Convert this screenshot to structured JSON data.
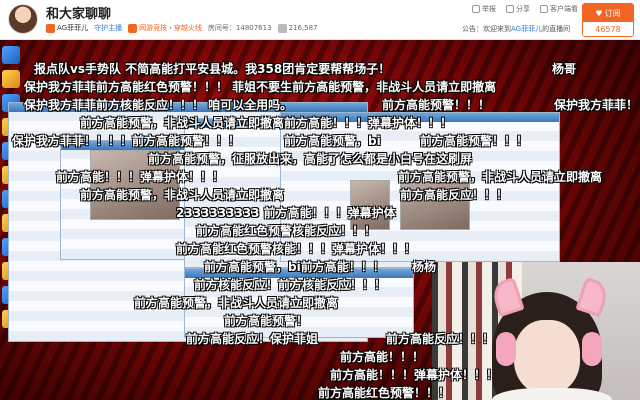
{
  "header": {
    "room_title": "和大家聊聊",
    "anchor_name": "AG菲菲儿",
    "guard_label": "守护主播",
    "category_1": "网游竞技",
    "category_2": "穿越火线",
    "room_number_label": "房间号：14807613",
    "popularity": "216,587",
    "report_label": "举报",
    "share_label": "分享",
    "client_label": "客户端看",
    "notice_prefix": "公告：欢迎来到",
    "notice_highlight": "AG菲菲儿",
    "notice_suffix": "的直播间",
    "subscribe_label": "订阅",
    "subscriber_count": "46578"
  },
  "danmaku": [
    "报点队vs手势队  不简高能打平安县城。我358团肯定要帮帮场子！",
    "杨哥",
    "保护我方菲菲前方高能红色预警！！！  菲姐不要生前方高能预警，非战斗人员请立即撤离",
    "保护我方菲菲前方核能反应！！！  咱可以全用吗。",
    "前方高能预警！！！",
    "保护我方菲菲！",
    "前方高能预警，非战斗人员请立即撤离前方高能！！！弹幕护体！！！",
    "保护我方菲菲！！！！前方高能预警！！！",
    "前方高能预警，bi",
    "前方高能预警！！！",
    "前方高能预警，征服放出来，高能了怎么都是小白号在这刷屏",
    "前方高能！！！弹幕护体！！！",
    "前方高能预警，非战斗人员请立即撤离",
    "前方高能预警，非战斗人员请立即撤离",
    "前方高能反应！！！",
    "2333333333 前方高能！！！弹幕护体",
    "前方高能红色预警核能反应！！！",
    "前方高能红色预警核能！！！弹幕护体！！！",
    "前方高能预警，bi前方高能！！！",
    "杨杨",
    "前方核能反应！前方核能反应！！！",
    "前方高能预警，非战斗人员请立即撤离",
    "前方高能预警！",
    "前方高能反应！保护菲姐",
    "前方高能反应！！！",
    "前方高能！！！",
    "前方高能！！！弹幕护体！！！",
    "前方高能红色预警！！！"
  ]
}
